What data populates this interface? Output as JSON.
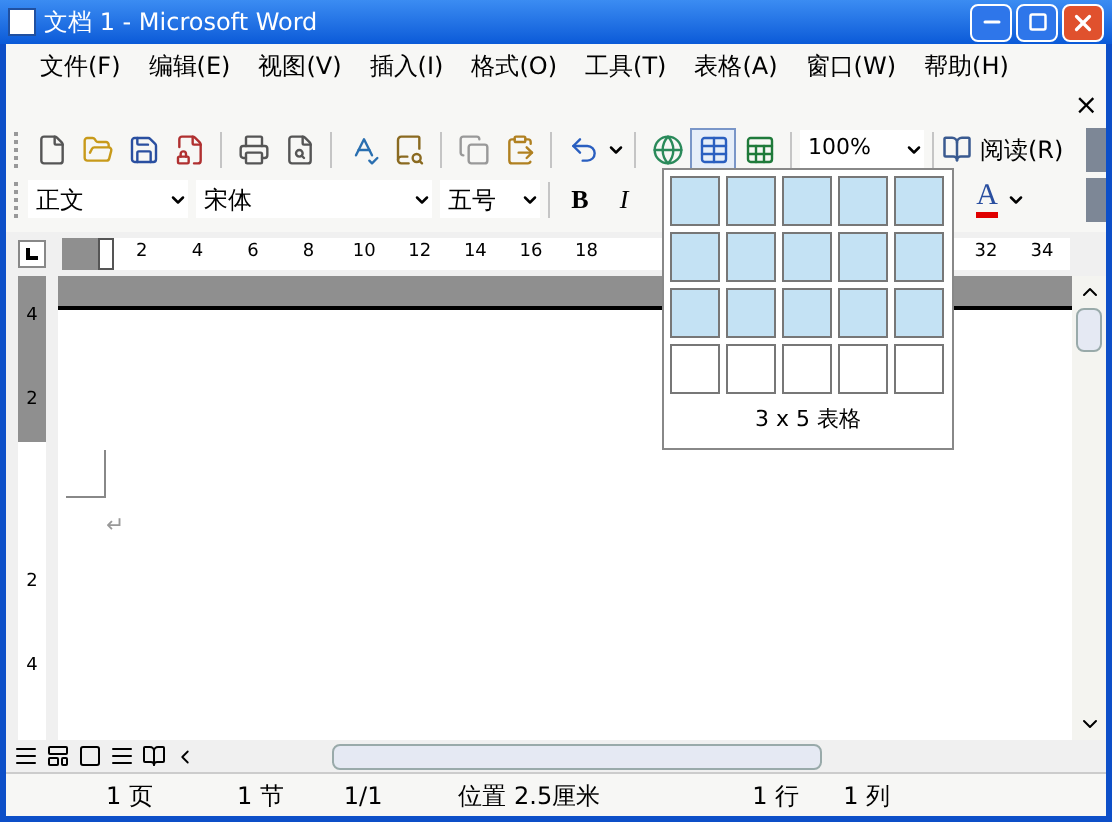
{
  "window": {
    "title": "文档 1 - Microsoft Word"
  },
  "menu": [
    {
      "label": "文件(F)"
    },
    {
      "label": "编辑(E)"
    },
    {
      "label": "视图(V)"
    },
    {
      "label": "插入(I)"
    },
    {
      "label": "格式(O)"
    },
    {
      "label": "工具(T)"
    },
    {
      "label": "表格(A)"
    },
    {
      "label": "窗口(W)"
    },
    {
      "label": "帮助(H)"
    }
  ],
  "menu_close": "×",
  "standard_toolbar": {
    "buttons": [
      {
        "kind": "new",
        "pressed": false
      },
      {
        "kind": "open",
        "pressed": false
      },
      {
        "kind": "save",
        "pressed": false
      },
      {
        "kind": "permission",
        "pressed": false
      },
      {
        "kind": "sep"
      },
      {
        "kind": "print",
        "pressed": false
      },
      {
        "kind": "preview",
        "pressed": false
      },
      {
        "kind": "sep"
      },
      {
        "kind": "spelling",
        "pressed": false
      },
      {
        "kind": "research",
        "pressed": false
      },
      {
        "kind": "sep"
      },
      {
        "kind": "copy",
        "pressed": false
      },
      {
        "kind": "paste",
        "pressed": false
      },
      {
        "kind": "sep"
      },
      {
        "kind": "undo",
        "pressed": false
      },
      {
        "kind": "sep"
      },
      {
        "kind": "hyperlink",
        "pressed": false
      },
      {
        "kind": "table",
        "pressed": true
      },
      {
        "kind": "excel",
        "pressed": false
      }
    ],
    "zoom": "100%",
    "read_button": "阅读(R)"
  },
  "formatting_toolbar": {
    "style": "正文",
    "font": "宋体",
    "size": "五号",
    "bold": "B",
    "italic": "I",
    "font_color": "A"
  },
  "ruler": {
    "ticks": [
      "2",
      "4",
      "6",
      "8",
      "10",
      "12",
      "14",
      "16",
      "18"
    ],
    "right_ticks": [
      "32",
      "34"
    ]
  },
  "vertical_ruler": [
    {
      "label": "4",
      "shaded": true
    },
    {
      "label": "2",
      "shaded": true
    },
    {
      "label": "2",
      "shaded": false
    },
    {
      "label": "4",
      "shaded": false
    }
  ],
  "document": {
    "paragraph_mark": "↵"
  },
  "table_picker": {
    "rows": [
      {
        "cells": [
          {
            "selected": true
          },
          {
            "selected": true
          },
          {
            "selected": true
          },
          {
            "selected": true
          },
          {
            "selected": true
          }
        ]
      },
      {
        "cells": [
          {
            "selected": true
          },
          {
            "selected": true
          },
          {
            "selected": true
          },
          {
            "selected": true
          },
          {
            "selected": true
          }
        ]
      },
      {
        "cells": [
          {
            "selected": true
          },
          {
            "selected": true
          },
          {
            "selected": true
          },
          {
            "selected": true
          },
          {
            "selected": true
          }
        ]
      },
      {
        "cells": [
          {
            "selected": false
          },
          {
            "selected": false
          },
          {
            "selected": false
          },
          {
            "selected": false
          },
          {
            "selected": false
          }
        ]
      }
    ],
    "label": "3 x 5 表格"
  },
  "status_bar": [
    "1 页",
    "1 节",
    "1/1",
    "位置 2.5厘米",
    "1 行",
    "1 列"
  ]
}
